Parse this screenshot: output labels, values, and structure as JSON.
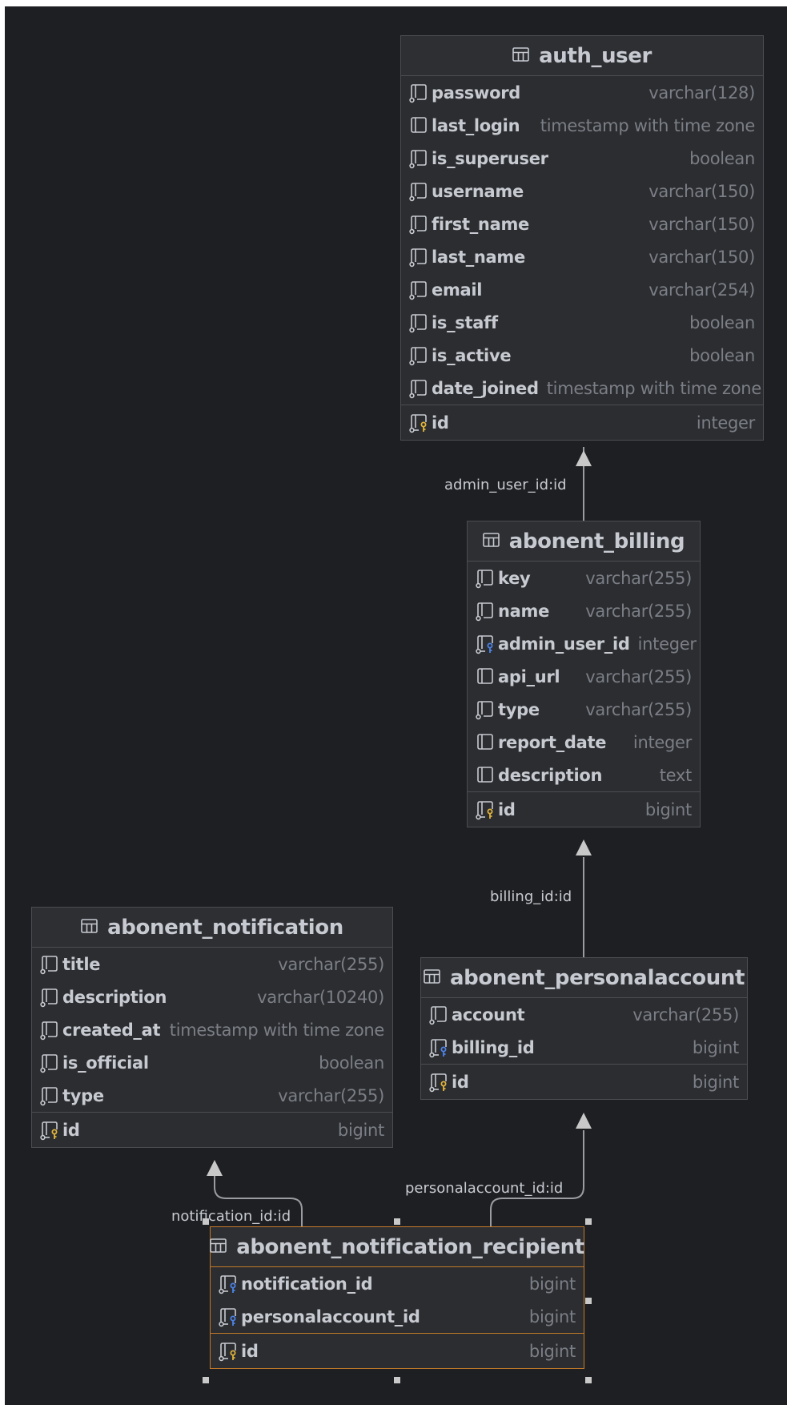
{
  "tables": {
    "auth_user": {
      "name": "auth_user",
      "columns": [
        {
          "name": "password",
          "type": "varchar(128)"
        },
        {
          "name": "last_login",
          "type": "timestamp with time zone"
        },
        {
          "name": "is_superuser",
          "type": "boolean"
        },
        {
          "name": "username",
          "type": "varchar(150)"
        },
        {
          "name": "first_name",
          "type": "varchar(150)"
        },
        {
          "name": "last_name",
          "type": "varchar(150)"
        },
        {
          "name": "email",
          "type": "varchar(254)"
        },
        {
          "name": "is_staff",
          "type": "boolean"
        },
        {
          "name": "is_active",
          "type": "boolean"
        },
        {
          "name": "date_joined",
          "type": "timestamp with time zone"
        }
      ],
      "pk": {
        "name": "id",
        "type": "integer"
      }
    },
    "abonent_billing": {
      "name": "abonent_billing",
      "columns": [
        {
          "name": "key",
          "type": "varchar(255)"
        },
        {
          "name": "name",
          "type": "varchar(255)"
        },
        {
          "name": "admin_user_id",
          "type": "integer"
        },
        {
          "name": "api_url",
          "type": "varchar(255)"
        },
        {
          "name": "type",
          "type": "varchar(255)"
        },
        {
          "name": "report_date",
          "type": "integer"
        },
        {
          "name": "description",
          "type": "text"
        }
      ],
      "pk": {
        "name": "id",
        "type": "bigint"
      }
    },
    "abonent_notification": {
      "name": "abonent_notification",
      "columns": [
        {
          "name": "title",
          "type": "varchar(255)"
        },
        {
          "name": "description",
          "type": "varchar(10240)"
        },
        {
          "name": "created_at",
          "type": "timestamp with time zone"
        },
        {
          "name": "is_official",
          "type": "boolean"
        },
        {
          "name": "type",
          "type": "varchar(255)"
        }
      ],
      "pk": {
        "name": "id",
        "type": "bigint"
      }
    },
    "abonent_personalaccount": {
      "name": "abonent_personalaccount",
      "columns": [
        {
          "name": "account",
          "type": "varchar(255)"
        },
        {
          "name": "billing_id",
          "type": "bigint"
        }
      ],
      "pk": {
        "name": "id",
        "type": "bigint"
      }
    },
    "abonent_notification_recipient": {
      "name": "abonent_notification_recipient",
      "columns": [
        {
          "name": "notification_id",
          "type": "bigint"
        },
        {
          "name": "personalaccount_id",
          "type": "bigint"
        }
      ],
      "pk": {
        "name": "id",
        "type": "bigint"
      }
    }
  },
  "relations": {
    "admin_user": "admin_user_id:id",
    "billing": "billing_id:id",
    "personalaccount": "personalaccount_id:id",
    "notification": "notification_id:id"
  },
  "icons": {
    "table": "table-icon",
    "column": "column-icon",
    "column_notnull": "column-notnull-icon",
    "foreign_key": "foreign-key-icon",
    "primary_key": "primary-key-icon"
  },
  "colors": {
    "background": "#1e1f22",
    "table_bg": "#2b2d30",
    "border": "#4b4d52",
    "text": "#c7cad1",
    "type_text": "#7b7e86",
    "selected": "#c47a29",
    "pk_key": "#e0b33c",
    "fk_key": "#4d82e6"
  }
}
